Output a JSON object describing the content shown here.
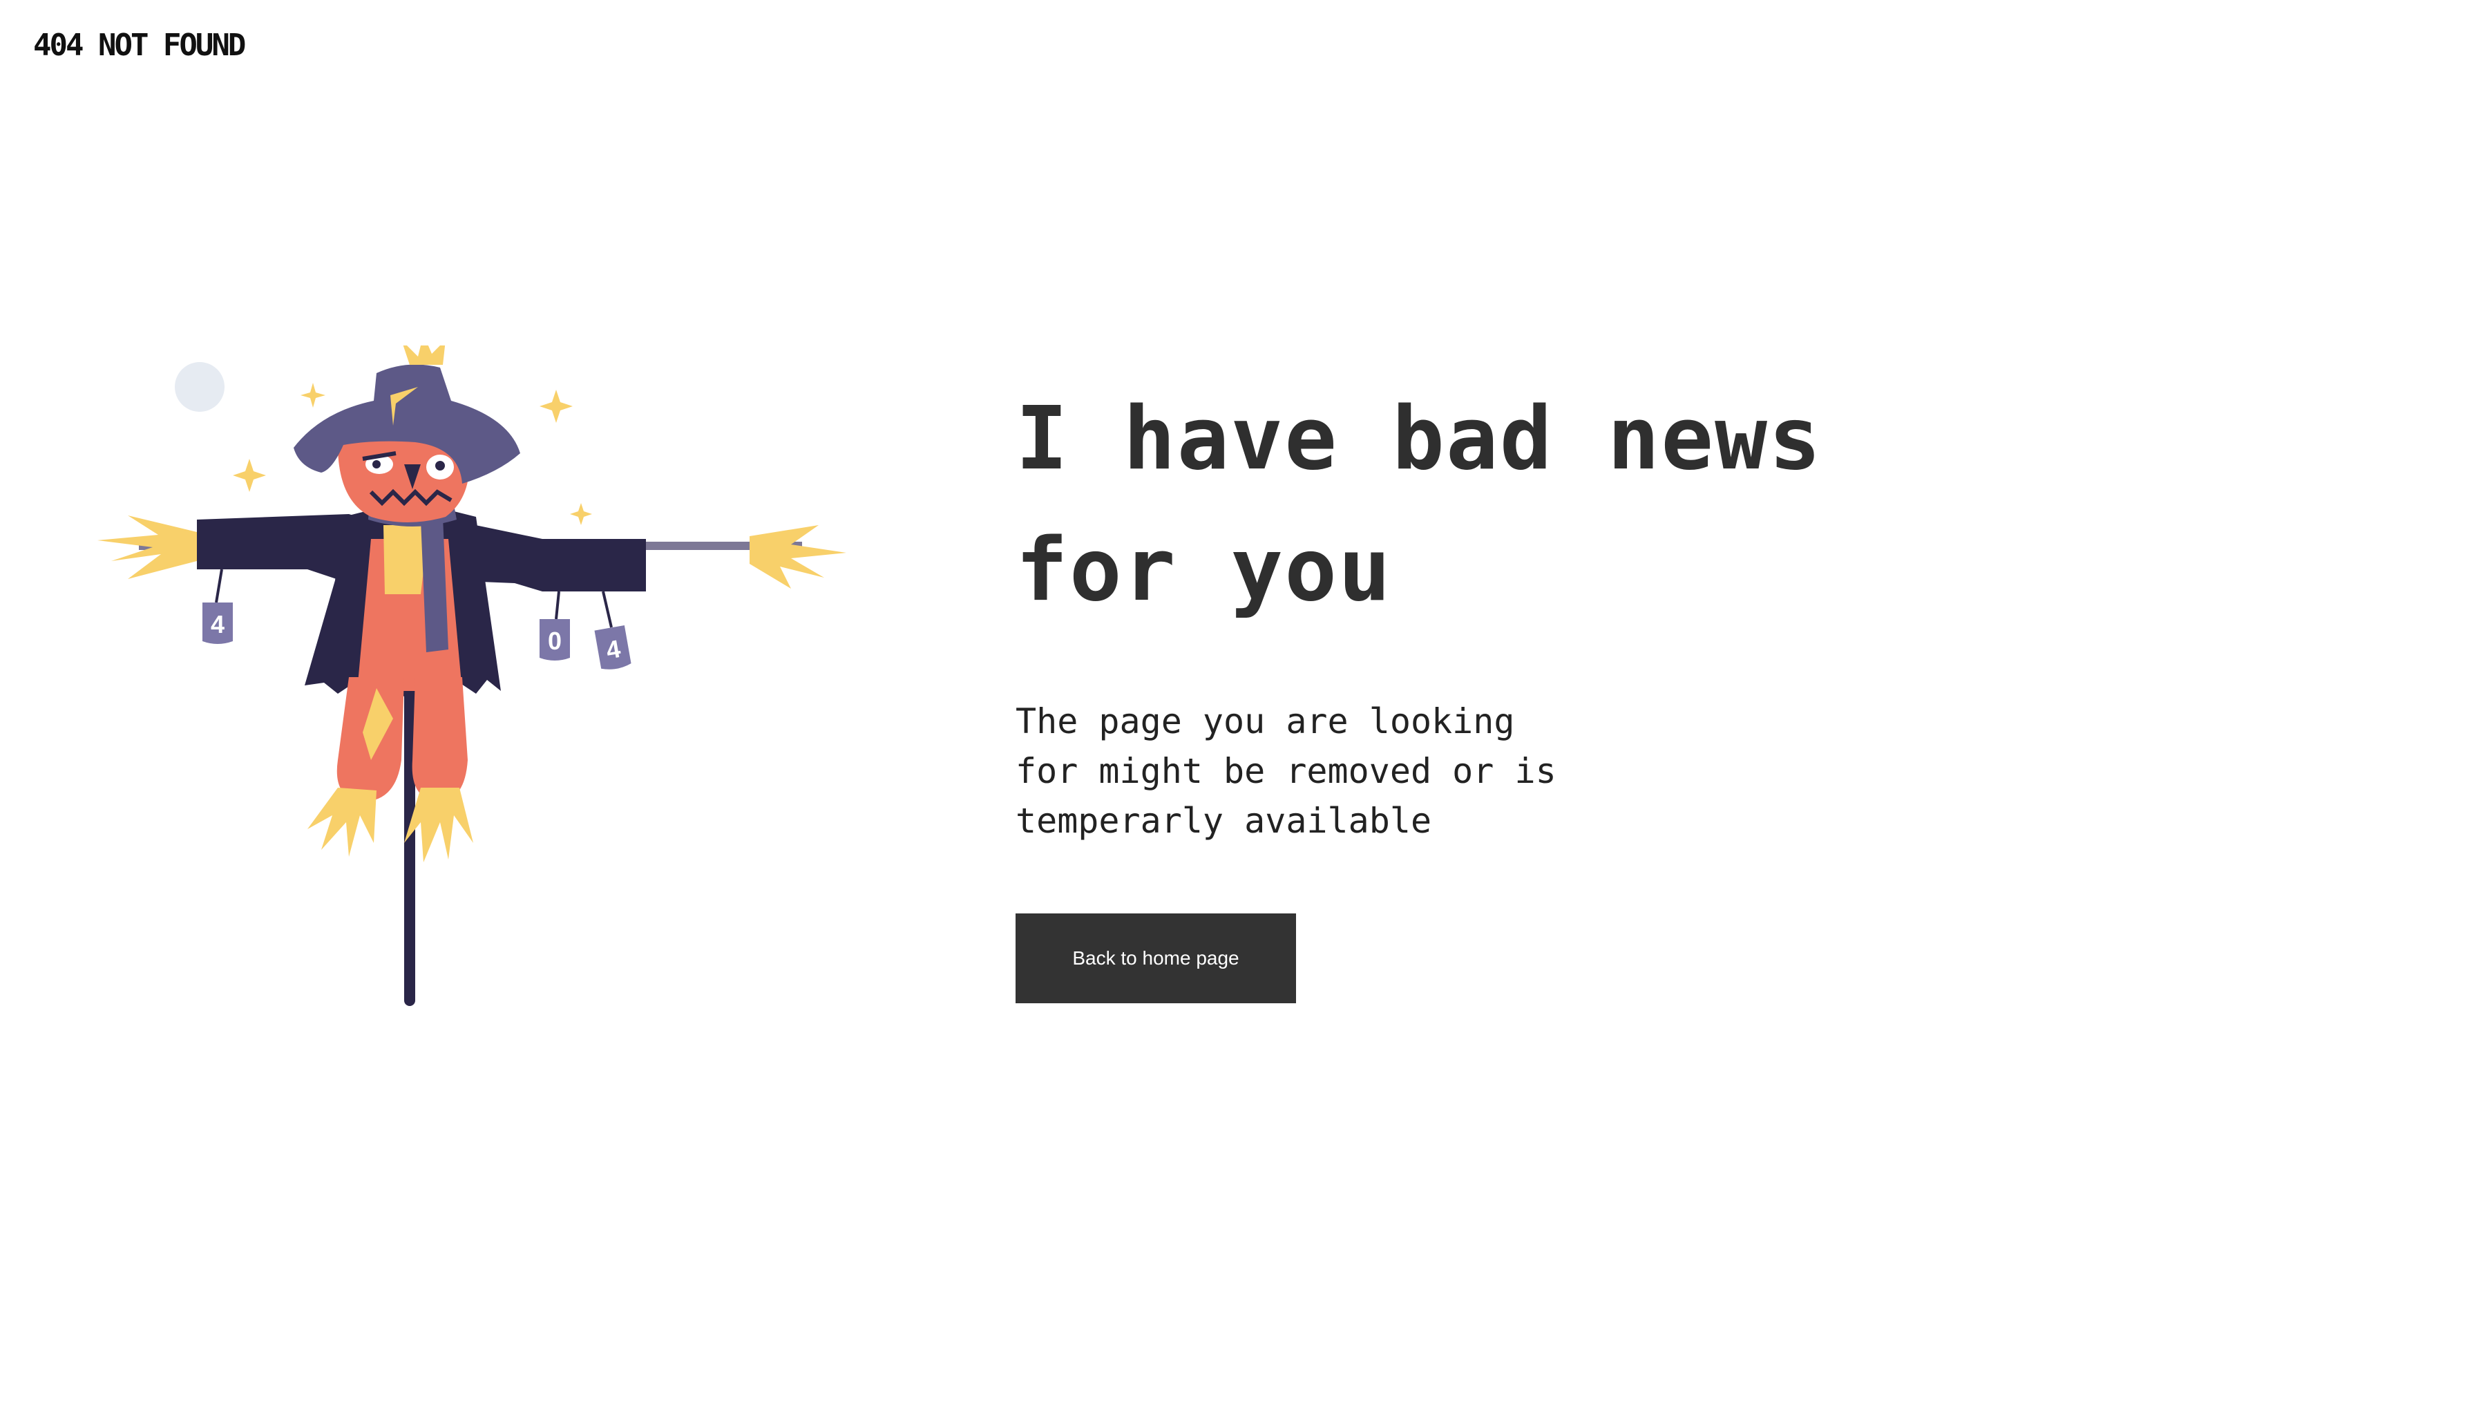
{
  "header": {
    "brand": "404 NOT FOUND"
  },
  "main": {
    "headline_line1": "I have bad news",
    "headline_line2": "for you",
    "message_line1": "The page you are looking",
    "message_line2": "for might be removed or is",
    "message_line3": "temperarly available",
    "button_label": "Back to home page"
  },
  "illustration": {
    "can_left_label": "4",
    "can_middle_label": "0",
    "can_right_label": "4",
    "colors": {
      "coat": "#2a2648",
      "hat": "#5d5987",
      "face": "#ee7560",
      "straw": "#f8d06a",
      "scarf": "#5d5987",
      "moon": "#e6ebf2",
      "can": "#7c77a8"
    }
  }
}
